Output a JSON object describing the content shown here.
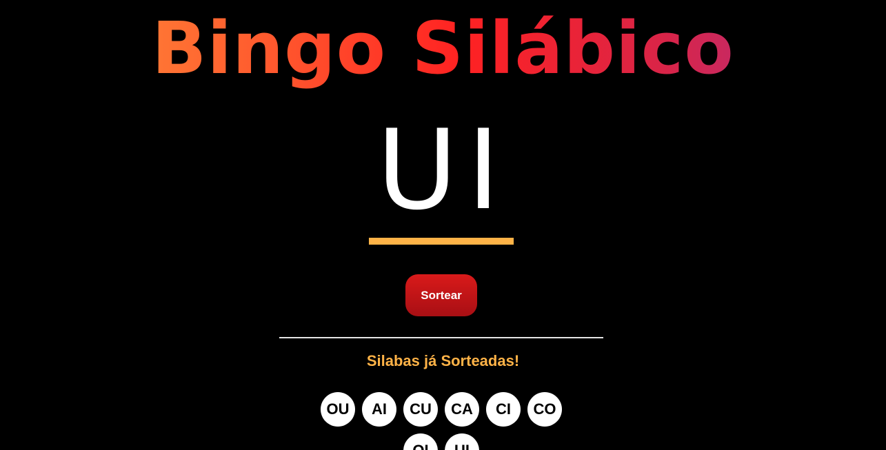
{
  "header": {
    "title": "Bingo Silábico"
  },
  "current": {
    "syllable": "UI"
  },
  "controls": {
    "draw_label": "Sortear"
  },
  "drawn": {
    "heading": "Silabas já Sorteadas!",
    "syllables": [
      "OU",
      "AI",
      "CU",
      "CA",
      "CI",
      "CO",
      "OI",
      "UI"
    ]
  },
  "colors": {
    "background": "#000000",
    "accent": "#ffb347",
    "button": "#c41518",
    "title_gradient": [
      "#ff9a3c",
      "#ff2222",
      "#a53393"
    ]
  }
}
